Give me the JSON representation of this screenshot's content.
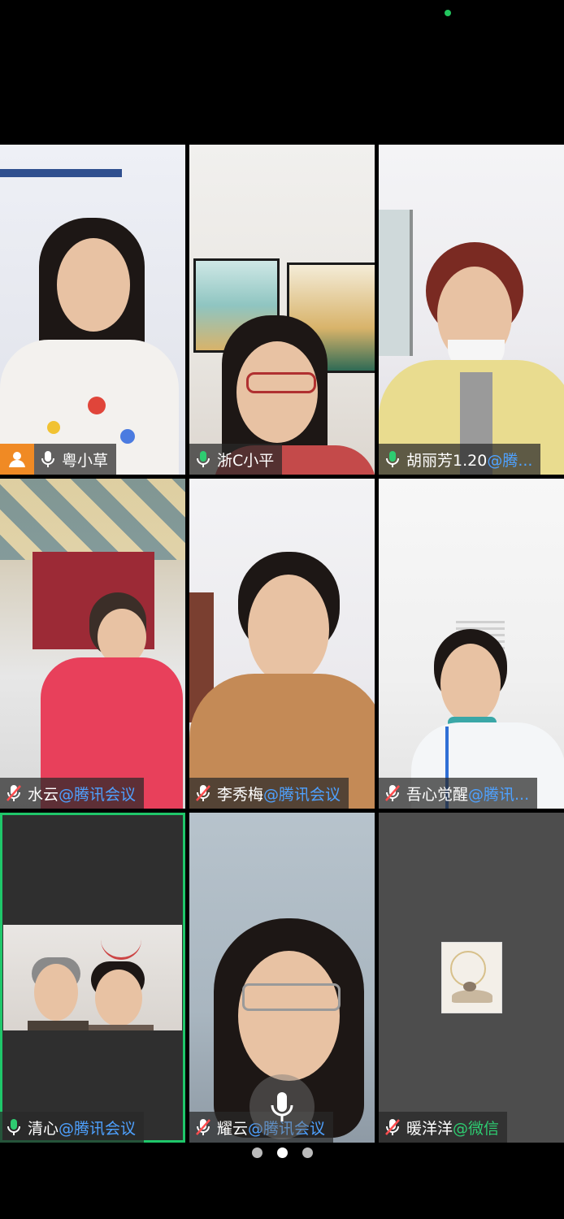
{
  "tiles": [
    {
      "name": "粤小草",
      "tag": "",
      "mic": "on",
      "host": true,
      "active": false
    },
    {
      "name": "浙C小平",
      "tag": "",
      "mic": "on",
      "host": false,
      "active": false
    },
    {
      "name": "胡丽芳1.20",
      "tag": "@腾...",
      "mic": "on",
      "host": false,
      "active": false
    },
    {
      "name": "水云",
      "tag": "@腾讯会议",
      "mic": "muted",
      "host": false,
      "active": false
    },
    {
      "name": "李秀梅",
      "tag": "@腾讯会议",
      "mic": "muted",
      "host": false,
      "active": false
    },
    {
      "name": "吾心觉醒",
      "tag": "@腾讯...",
      "mic": "muted",
      "host": false,
      "active": false
    },
    {
      "name": "清心",
      "tag": "@腾讯会议",
      "mic": "on",
      "host": false,
      "active": true
    },
    {
      "name": "耀云",
      "tag": "@腾讯会议",
      "mic": "muted",
      "host": false,
      "active": false
    },
    {
      "name": "暖洋洋",
      "tag": "@微信",
      "mic": "muted",
      "host": false,
      "active": false
    }
  ],
  "pager": {
    "pages": 3,
    "current": 1
  },
  "colors": {
    "accent": "#1fc76a",
    "host_badge": "#f08a24",
    "tag": "#4ea1ff"
  },
  "icons": {
    "mic": "microphone-icon",
    "mic_muted": "microphone-muted-icon",
    "host": "host-user-icon"
  }
}
